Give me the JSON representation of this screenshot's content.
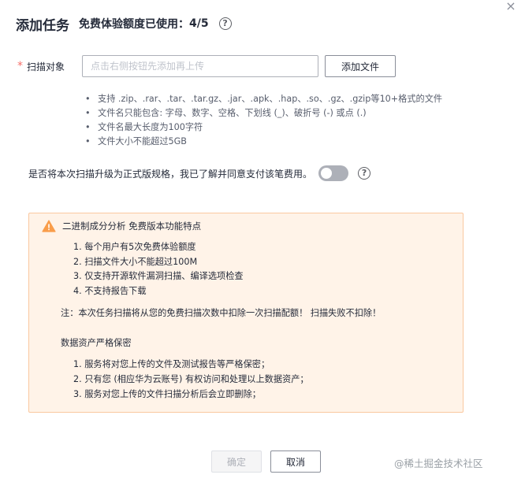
{
  "dialog": {
    "title": "添加任务",
    "quota_label": "免费体验额度已使用：",
    "quota_value": "4/5",
    "help_glyph": "?",
    "close_glyph": "×"
  },
  "scan_target": {
    "label": "扫描对象",
    "placeholder": "点击右侧按钮先添加再上传",
    "value": "",
    "add_file_button": "添加文件"
  },
  "hints": [
    "支持 .zip、.rar、.tar、.tar.gz、.jar、.apk、.hap、.so、.gz、.gzip等10+格式的文件",
    "文件名只能包含: 字母、数字、空格、下划线 (_)、破折号 (-) 或点 (.)",
    "文件名最大长度为100字符",
    "文件大小不能超过5GB"
  ],
  "upgrade": {
    "text": "是否将本次扫描升级为正式版规格，我已了解并同意支付该笔费用。",
    "enabled": false
  },
  "notice": {
    "title": "二进制成分分析 免费版本功能特点",
    "features": [
      "1. 每个用户有5次免费体验额度",
      "2. 扫描文件大小不能超过100M",
      "3. 仅支持开源软件漏洞扫描、编译选项检查",
      "4. 不支持报告下载"
    ],
    "note": "注：本次任务扫描将从您的免费扫描次数中扣除一次扫描配额！ 扫描失败不扣除！",
    "privacy_title": "数据资产严格保密",
    "privacy_items": [
      "1. 服务将对您上传的文件及测试报告等严格保密；",
      "2. 只有您 (相应华为云账号) 有权访问和处理以上数据资产；",
      "3. 服务对您上传的文件扫描分析后会立即删除；"
    ],
    "colors": {
      "background": "#fff3e8",
      "border": "#fac8a0",
      "icon": "#f99d4a"
    }
  },
  "footer": {
    "confirm_button": "确定",
    "confirm_enabled": false,
    "cancel_button": "取消"
  },
  "watermark": "@稀土掘金技术社区"
}
